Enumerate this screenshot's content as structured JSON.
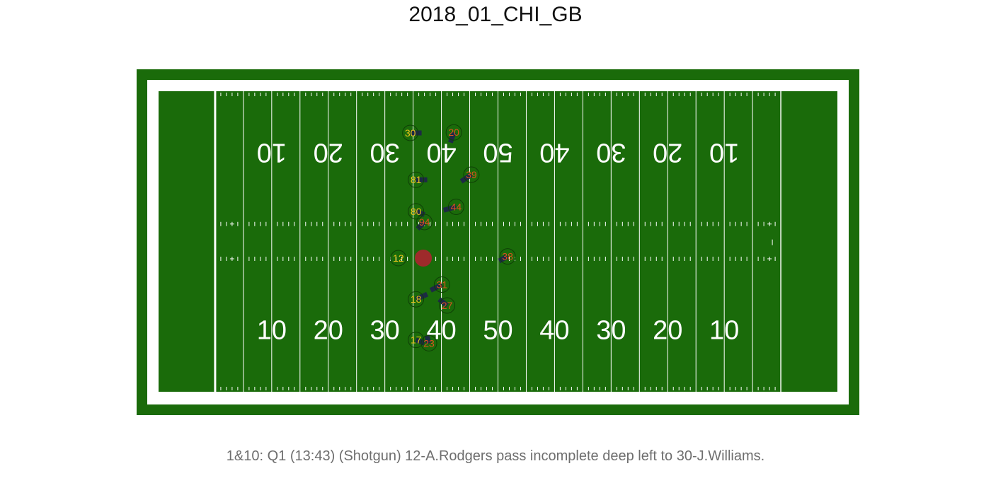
{
  "title": "2018_01_CHI_GB",
  "caption": "1&10: Q1 (13:43) (Shotgun) 12-A.Rodgers pass incomplete deep left to 30-J.Williams.",
  "colors": {
    "outer_border": "#1a6b0a",
    "turf": "#1a6b0a",
    "line": "#ffffff",
    "football": "#9e2a2b",
    "offense_label": "#e8c21a",
    "defense_label": "#d9531e",
    "arrow": "#1d2a44",
    "ring": "#0f3f07"
  },
  "chart_data": {
    "type": "scatter",
    "title": "2018_01_CHI_GB",
    "caption": "1&10: Q1 (13:43) (Shotgun) 12-A.Rodgers pass incomplete deep left to 30-J.Williams.",
    "field": {
      "x_range": [
        0,
        120
      ],
      "y_range": [
        0,
        53.3
      ],
      "endzone_yards": 10
    },
    "yard_numbers": [
      "10",
      "20",
      "30",
      "40",
      "50",
      "40",
      "30",
      "20",
      "10"
    ],
    "football": {
      "x": 46.8,
      "y": 23.7
    },
    "players": [
      {
        "jersey": "12",
        "team": "offense",
        "x": 42.4,
        "y": 23.7,
        "dir_x": 0,
        "dir_y": 0
      },
      {
        "jersey": "30",
        "team": "offense",
        "x": 44.5,
        "y": 45.9,
        "dir_x": 2.0,
        "dir_y": 0
      },
      {
        "jersey": "81",
        "team": "offense",
        "x": 45.5,
        "y": 37.6,
        "dir_x": 2.0,
        "dir_y": 0
      },
      {
        "jersey": "80",
        "team": "offense",
        "x": 45.5,
        "y": 32.0,
        "dir_x": 1.5,
        "dir_y": -0.6
      },
      {
        "jersey": "18",
        "team": "offense",
        "x": 45.5,
        "y": 16.4,
        "dir_x": 2.0,
        "dir_y": 0.9
      },
      {
        "jersey": "17",
        "team": "offense",
        "x": 45.5,
        "y": 9.2,
        "dir_x": 1.5,
        "dir_y": -0.6
      },
      {
        "jersey": "20",
        "team": "defense",
        "x": 52.2,
        "y": 46.0,
        "dir_x": -0.6,
        "dir_y": -1.8
      },
      {
        "jersey": "39",
        "team": "defense",
        "x": 55.3,
        "y": 38.5,
        "dir_x": -1.8,
        "dir_y": -1.2
      },
      {
        "jersey": "44",
        "team": "defense",
        "x": 52.6,
        "y": 32.8,
        "dir_x": -2.2,
        "dir_y": -0.6
      },
      {
        "jersey": "94",
        "team": "defense",
        "x": 47.0,
        "y": 30.1,
        "dir_x": -1.2,
        "dir_y": -1.2
      },
      {
        "jersey": "38",
        "team": "defense",
        "x": 61.7,
        "y": 24.0,
        "dir_x": -1.5,
        "dir_y": -0.8
      },
      {
        "jersey": "31",
        "team": "defense",
        "x": 50.1,
        "y": 19.0,
        "dir_x": -2.0,
        "dir_y": -1.0
      },
      {
        "jersey": "27",
        "team": "defense",
        "x": 51.0,
        "y": 15.3,
        "dir_x": -1.4,
        "dir_y": 1.1
      },
      {
        "jersey": "23",
        "team": "defense",
        "x": 47.8,
        "y": 8.6,
        "dir_x": -0.4,
        "dir_y": 1.4
      }
    ]
  }
}
